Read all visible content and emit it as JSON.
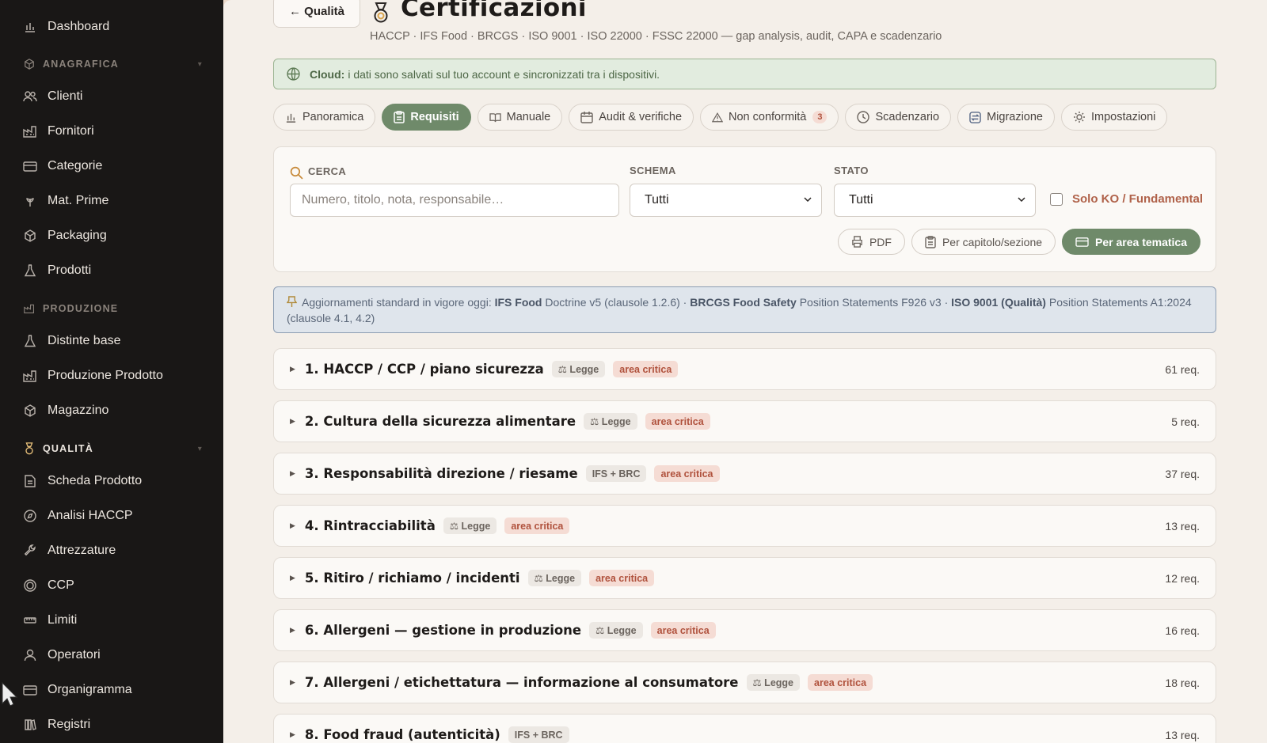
{
  "sidebar": {
    "items": [
      {
        "label": "Dashboard",
        "icon": "bar-chart-icon"
      },
      {
        "label": "Clienti",
        "icon": "users-icon"
      },
      {
        "label": "Fornitori",
        "icon": "factory-icon"
      },
      {
        "label": "Categorie",
        "icon": "folder-icon"
      },
      {
        "label": "Mat. Prime",
        "icon": "wheat-icon"
      },
      {
        "label": "Packaging",
        "icon": "box-icon"
      },
      {
        "label": "Prodotti",
        "icon": "flask-icon"
      },
      {
        "label": "Distinte base",
        "icon": "flask-icon"
      },
      {
        "label": "Produzione Prodotto",
        "icon": "factory-icon"
      },
      {
        "label": "Magazzino",
        "icon": "box-icon"
      },
      {
        "label": "Scheda Prodotto",
        "icon": "document-icon"
      },
      {
        "label": "Analisi HACCP",
        "icon": "compass-icon"
      },
      {
        "label": "Attrezzature",
        "icon": "wrench-icon"
      },
      {
        "label": "CCP",
        "icon": "target-icon"
      },
      {
        "label": "Limiti",
        "icon": "ruler-icon"
      },
      {
        "label": "Operatori",
        "icon": "user-icon"
      },
      {
        "label": "Organigramma",
        "icon": "folder-icon"
      },
      {
        "label": "Registri",
        "icon": "books-icon"
      }
    ],
    "sections": {
      "anagrafica": "ANAGRAFICA",
      "produzione": "PRODUZIONE",
      "qualita": "QUALITÀ"
    }
  },
  "header": {
    "back_label": "← Qualità",
    "title": "Certificazioni",
    "subtitle": "HACCP · IFS Food · BRCGS · ISO 9001 · ISO 22000 · FSSC 22000 — gap analysis, audit, CAPA e scadenzario"
  },
  "cloud": {
    "label": "Cloud:",
    "text": "i dati sono salvati sul tuo account e sincronizzati tra i dispositivi."
  },
  "tabs": [
    {
      "label": "Panoramica"
    },
    {
      "label": "Requisiti"
    },
    {
      "label": "Manuale"
    },
    {
      "label": "Audit & verifiche"
    },
    {
      "label": "Non conformità",
      "badge": "3"
    },
    {
      "label": "Scadenzario"
    },
    {
      "label": "Migrazione"
    },
    {
      "label": "Impostazioni"
    }
  ],
  "filters": {
    "search_label": "CERCA",
    "search_placeholder": "Numero, titolo, nota, responsabile…",
    "schema_label": "SCHEMA",
    "schema_value": "Tutti",
    "stato_label": "STATO",
    "stato_value": "Tutti",
    "ko_label": "Solo KO / Fundamental",
    "pdf_label": "PDF",
    "per_capitolo_label": "Per capitolo/sezione",
    "per_area_label": "Per area tematica"
  },
  "notice": {
    "prefix": "Aggiornamenti standard in vigore oggi:",
    "ifs_name": "IFS Food",
    "ifs_text": "Doctrine v5 (clausole 1.2.6) ·",
    "brc_name": "BRCGS Food Safety",
    "brc_text": "Position Statements F926 v3 ·",
    "iso_name": "ISO 9001 (Qualità)",
    "iso_text": "Position Statements A1:2024 (clausole 4.1, 4.2)"
  },
  "sections": [
    {
      "title": "1. HACCP / CCP / piano sicurezza",
      "tag": "⚖ Legge",
      "critical": "area critica",
      "count": "61 req."
    },
    {
      "title": "2. Cultura della sicurezza alimentare",
      "tag": "⚖ Legge",
      "critical": "area critica",
      "count": "5 req."
    },
    {
      "title": "3. Responsabilità direzione / riesame",
      "tag": "IFS + BRC",
      "critical": "area critica",
      "count": "37 req."
    },
    {
      "title": "4. Rintracciabilità",
      "tag": "⚖ Legge",
      "critical": "area critica",
      "count": "13 req."
    },
    {
      "title": "5. Ritiro / richiamo / incidenti",
      "tag": "⚖ Legge",
      "critical": "area critica",
      "count": "12 req."
    },
    {
      "title": "6. Allergeni — gestione in produzione",
      "tag": "⚖ Legge",
      "critical": "area critica",
      "count": "16 req."
    },
    {
      "title": "7. Allergeni / etichettatura — informazione al consumatore",
      "tag": "⚖ Legge",
      "critical": "area critica",
      "count": "18 req."
    },
    {
      "title": "8. Food fraud (autenticità)",
      "tag": "IFS + BRC",
      "critical": "",
      "count": "13 req."
    }
  ],
  "colors": {
    "sidebar_bg": "#191716",
    "accent_green": "#6f8a6a",
    "critical_red": "#b0523d",
    "main_bg": "#f4efe9"
  }
}
